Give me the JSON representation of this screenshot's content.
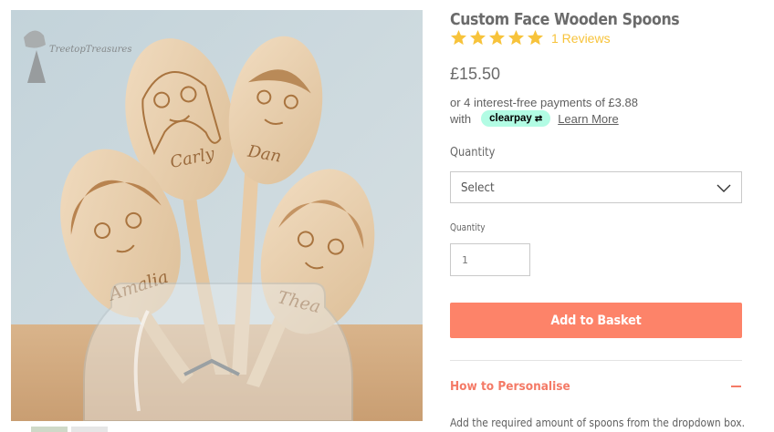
{
  "image": {
    "alt": "Custom Face Wooden Spoons in a glass jar",
    "watermark": "TreetopTreasures",
    "spoon_names": [
      "Carly",
      "Dan",
      "Amalia",
      "Thea"
    ]
  },
  "product": {
    "title": "Custom Face Wooden Spoons",
    "rating": 5,
    "reviews_label": "1 Reviews",
    "star_color": "#f7c33b",
    "price": "£15.50"
  },
  "clearpay": {
    "installments_text": "or 4 interest-free payments of £3.88",
    "with_label": "with",
    "badge_label": "clearpay",
    "learn_more": "Learn More",
    "badge_color": "#b2fce4"
  },
  "form": {
    "quantity_select_label": "Quantity",
    "select_value": "Select",
    "quantity_label": "Quantity",
    "quantity_value": "1",
    "add_button": "Add to Basket",
    "accent_color": "#fd8369"
  },
  "accordion": {
    "title": "How to Personalise",
    "toggle_icon": "minus-icon",
    "body": "Add the required amount of spoons from the dropdown box."
  }
}
